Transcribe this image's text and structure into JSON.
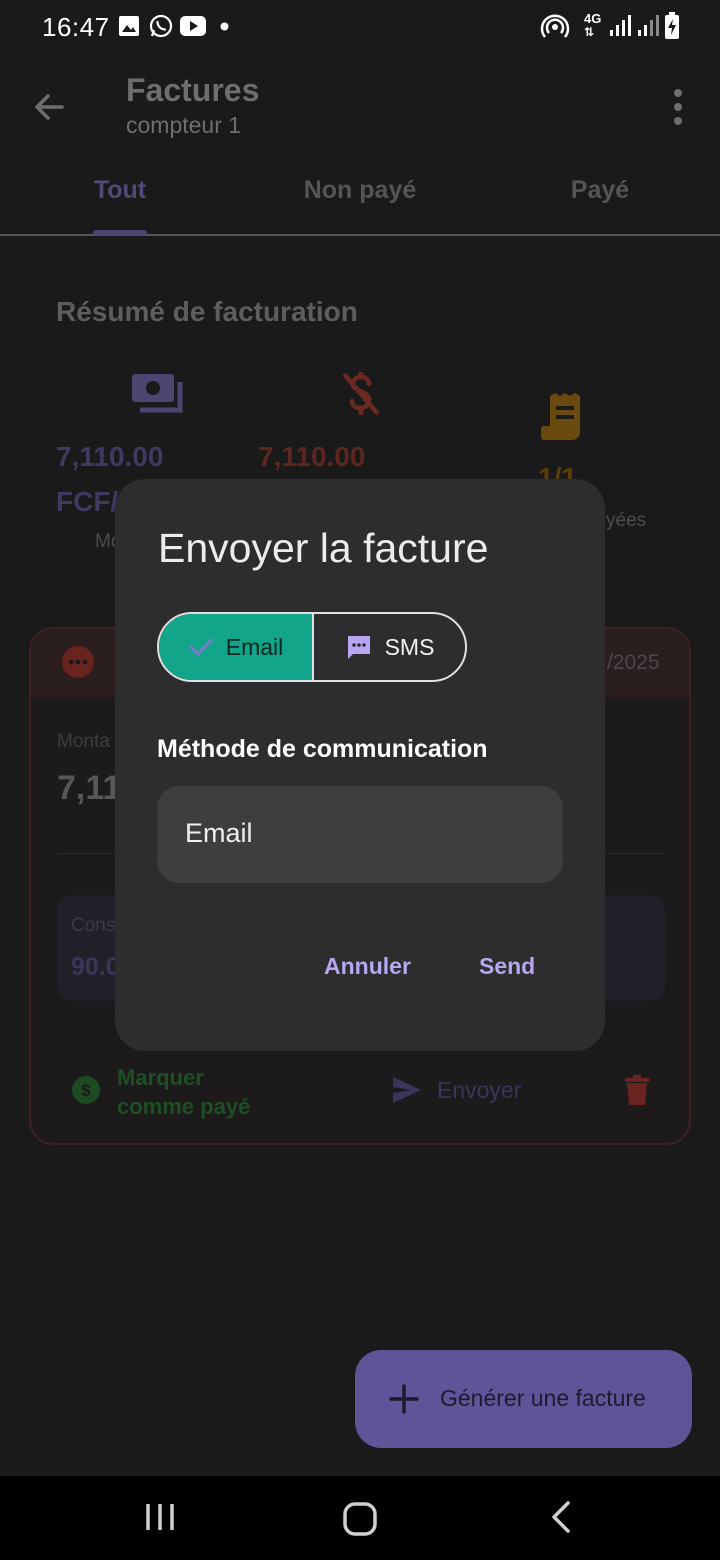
{
  "status_bar": {
    "time": "16:47",
    "network": "4G"
  },
  "app_bar": {
    "title": "Factures",
    "subtitle": "compteur 1"
  },
  "tabs": [
    {
      "label": "Tout",
      "active": true
    },
    {
      "label": "Non payé",
      "active": false
    },
    {
      "label": "Payé",
      "active": false
    }
  ],
  "summary": {
    "title": "Résumé de facturation",
    "total_amount_line1": "7,110.00",
    "total_amount_line2": "FCF/",
    "total_label_partial": "Mo",
    "unpaid_amount": "7,110.00",
    "count_value": "1/1",
    "count_label_partial": "yées"
  },
  "card": {
    "date_partial": "/2025",
    "amount_label_partial": "Monta",
    "amount_partial": "7,11",
    "consumption_label_partial": "Cons",
    "consumption_value_partial": "90.0",
    "mark_paid_line1": "Marquer",
    "mark_paid_line2": "comme payé",
    "send_label": "Envoyer"
  },
  "dialog": {
    "title": "Envoyer la facture",
    "options": [
      {
        "label": "Email",
        "selected": true
      },
      {
        "label": "SMS",
        "selected": false
      }
    ],
    "field_label": "Méthode de communication",
    "field_value": "Email",
    "cancel_label": "Annuler",
    "confirm_label": "Send"
  },
  "fab": {
    "label": "Générer une facture"
  },
  "colors": {
    "accent": "#b9a6f2",
    "selected_option": "#13a589",
    "fab": "#5f5497",
    "danger": "#c53929",
    "success": "#2e7d32"
  }
}
